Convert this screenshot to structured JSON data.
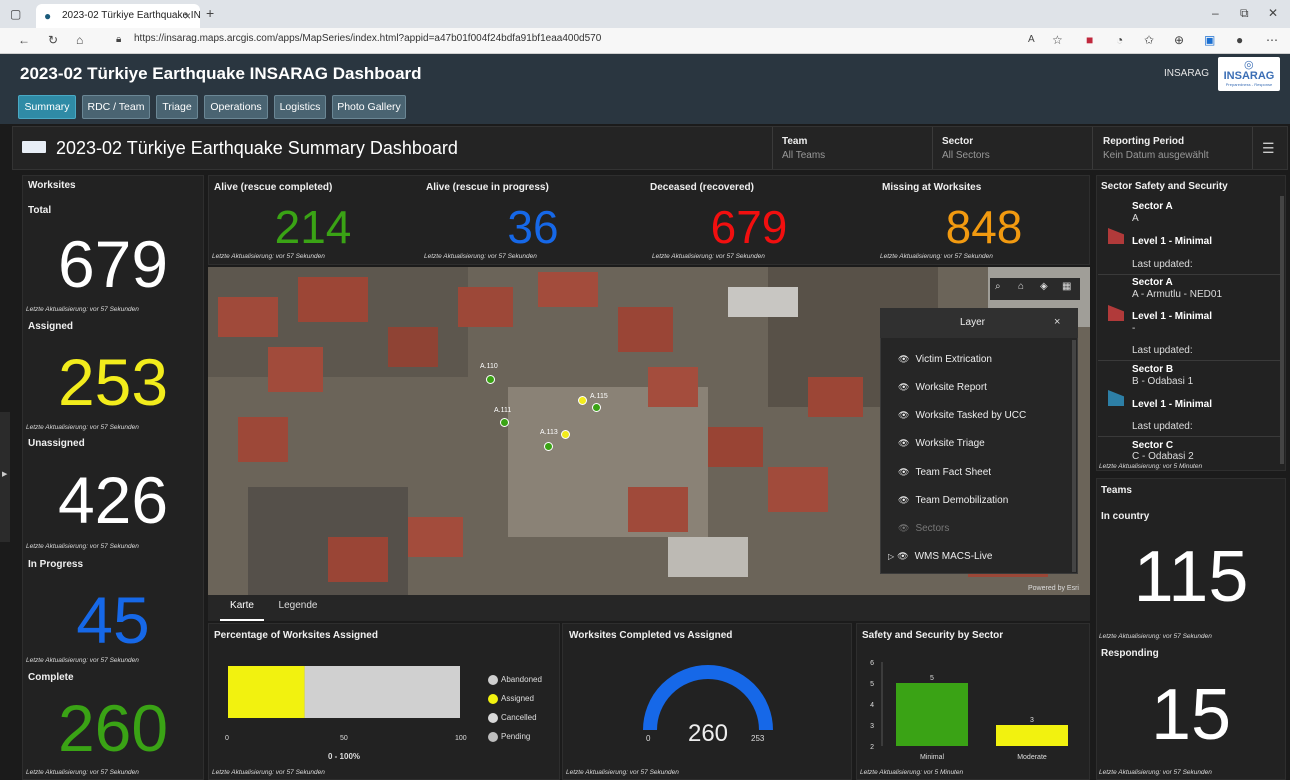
{
  "browser": {
    "tab_title": "2023-02 Türkiye Earthquake INSA",
    "url": "https://insarag.maps.arcgis.com/apps/MapSeries/index.html?appid=a47b01f004f24bdfa91bf1eaa400d570"
  },
  "app": {
    "title": "2023-02 Türkiye Earthquake INSARAG Dashboard",
    "org_label": "INSARAG",
    "logo_text": "INSARAG",
    "logo_sub": "Preparedness - Response",
    "tabs": [
      "Summary",
      "RDC / Team",
      "Triage",
      "Operations",
      "Logistics",
      "Photo Gallery"
    ]
  },
  "header": {
    "title": "2023-02 Türkiye Earthquake Summary Dashboard",
    "filters": [
      {
        "label": "Team",
        "value": "All Teams"
      },
      {
        "label": "Sector",
        "value": "All Sectors"
      },
      {
        "label": "Reporting Period",
        "value": "Kein Datum ausgewählt"
      }
    ]
  },
  "worksites": {
    "title": "Worksites",
    "items": [
      {
        "label": "Total",
        "value": "679",
        "color": "#ffffff",
        "updated": "Letzte Aktualisierung: vor 57 Sekunden"
      },
      {
        "label": "Assigned",
        "value": "253",
        "color": "#f2ec1c",
        "updated": "Letzte Aktualisierung: vor 57 Sekunden"
      },
      {
        "label": "Unassigned",
        "value": "426",
        "color": "#ffffff",
        "updated": "Letzte Aktualisierung: vor 57 Sekunden"
      },
      {
        "label": "In Progress",
        "value": "45",
        "color": "#1668e8",
        "updated": "Letzte Aktualisierung: vor 57 Sekunden"
      },
      {
        "label": "Complete",
        "value": "260",
        "color": "#3aa315",
        "updated": "Letzte Aktualisierung: vor 57 Sekunden"
      }
    ]
  },
  "indicators": [
    {
      "label": "Alive (rescue completed)",
      "value": "214",
      "color": "#3aa315",
      "updated": "Letzte Aktualisierung: vor 57 Sekunden"
    },
    {
      "label": "Alive (rescue in progress)",
      "value": "36",
      "color": "#1668e8",
      "updated": "Letzte Aktualisierung: vor 57 Sekunden"
    },
    {
      "label": "Deceased (recovered)",
      "value": "679",
      "color": "#f20f0f",
      "updated": "Letzte Aktualisierung: vor 57 Sekunden"
    },
    {
      "label": "Missing at Worksites",
      "value": "848",
      "color": "#f29a10",
      "updated": "Letzte Aktualisierung: vor 57 Sekunden"
    }
  ],
  "map": {
    "layer_panel_title": "Layer",
    "layers": [
      "Victim Extrication",
      "Worksite Report",
      "Worksite Tasked by UCC",
      "Worksite Triage",
      "Team Fact Sheet",
      "Team Demobilization",
      "Sectors",
      "WMS MACS-Live"
    ],
    "attribution": "Powered by Esri",
    "bottom_tabs": [
      "Karte",
      "Legende"
    ],
    "markers": [
      "A.110",
      "A.111",
      "A.115",
      "A.113"
    ]
  },
  "sector_safety": {
    "title": "Sector Safety and Security",
    "entries": [
      {
        "sector": "Sector A",
        "sub": "A",
        "level": "Level 1 - Minimal",
        "updated": "Last updated:",
        "flag": "#b13a3a"
      },
      {
        "sector": "Sector A",
        "sub": "A - Armutlu - NED01",
        "level": "Level 1 - Minimal",
        "extra": "-",
        "updated": "Last updated:",
        "flag": "#b13a3a"
      },
      {
        "sector": "Sector B",
        "sub": "B - Odabasi 1",
        "level": "Level 1 - Minimal",
        "updated": "Last updated:",
        "flag": "#2d7fa6"
      },
      {
        "sector": "Sector C",
        "sub": "C - Odabasi 2"
      }
    ],
    "updated_footer": "Letzte Aktualisierung: vor 5 Minuten"
  },
  "teams": {
    "title": "Teams",
    "items": [
      {
        "label": "In country",
        "value": "115",
        "updated": "Letzte Aktualisierung: vor 57 Sekunden"
      },
      {
        "label": "Responding",
        "value": "15",
        "updated": "Letzte Aktualisierung: vor 57 Sekunden"
      }
    ]
  },
  "pct_chart": {
    "title": "Percentage of Worksites Assigned",
    "updated": "Letzte Aktualisierung: vor 57 Sekunden",
    "axis_label": "0 - 100%",
    "ticks": [
      "0",
      "50",
      "100"
    ],
    "legend": [
      {
        "name": "Abandoned",
        "color": "#cfcfcf"
      },
      {
        "name": "Assigned",
        "color": "#f2f20f"
      },
      {
        "name": "Cancelled",
        "color": "#d8d8d8"
      },
      {
        "name": "Pending",
        "color": "#bdbdbd"
      }
    ]
  },
  "gauge": {
    "title": "Worksites Completed vs Assigned",
    "updated": "Letzte Aktualisierung: vor 57 Sekunden",
    "value_label": "260",
    "min_label": "0",
    "max_label": "253",
    "color": "#1668e8"
  },
  "safety_chart": {
    "title": "Safety and Security by Sector",
    "updated": "Letzte Aktualisierung: vor 5 Minuten",
    "y_ticks": [
      "2",
      "3",
      "4",
      "5",
      "6"
    ]
  },
  "chart_data": [
    {
      "type": "bar",
      "title": "Percentage of Worksites Assigned",
      "xlabel": "0 - 100%",
      "xlim": [
        0,
        100
      ],
      "orientation": "horizontal-stacked",
      "series": [
        {
          "name": "Assigned",
          "values": [
            33
          ]
        },
        {
          "name": "Pending",
          "values": [
            67
          ]
        }
      ]
    },
    {
      "type": "bar",
      "title": "Safety and Security by Sector",
      "categories": [
        "Minimal",
        "Moderate"
      ],
      "values": [
        5,
        3
      ],
      "colors": [
        "#3aa315",
        "#f2f20f"
      ],
      "ylim": [
        2,
        6
      ]
    }
  ]
}
